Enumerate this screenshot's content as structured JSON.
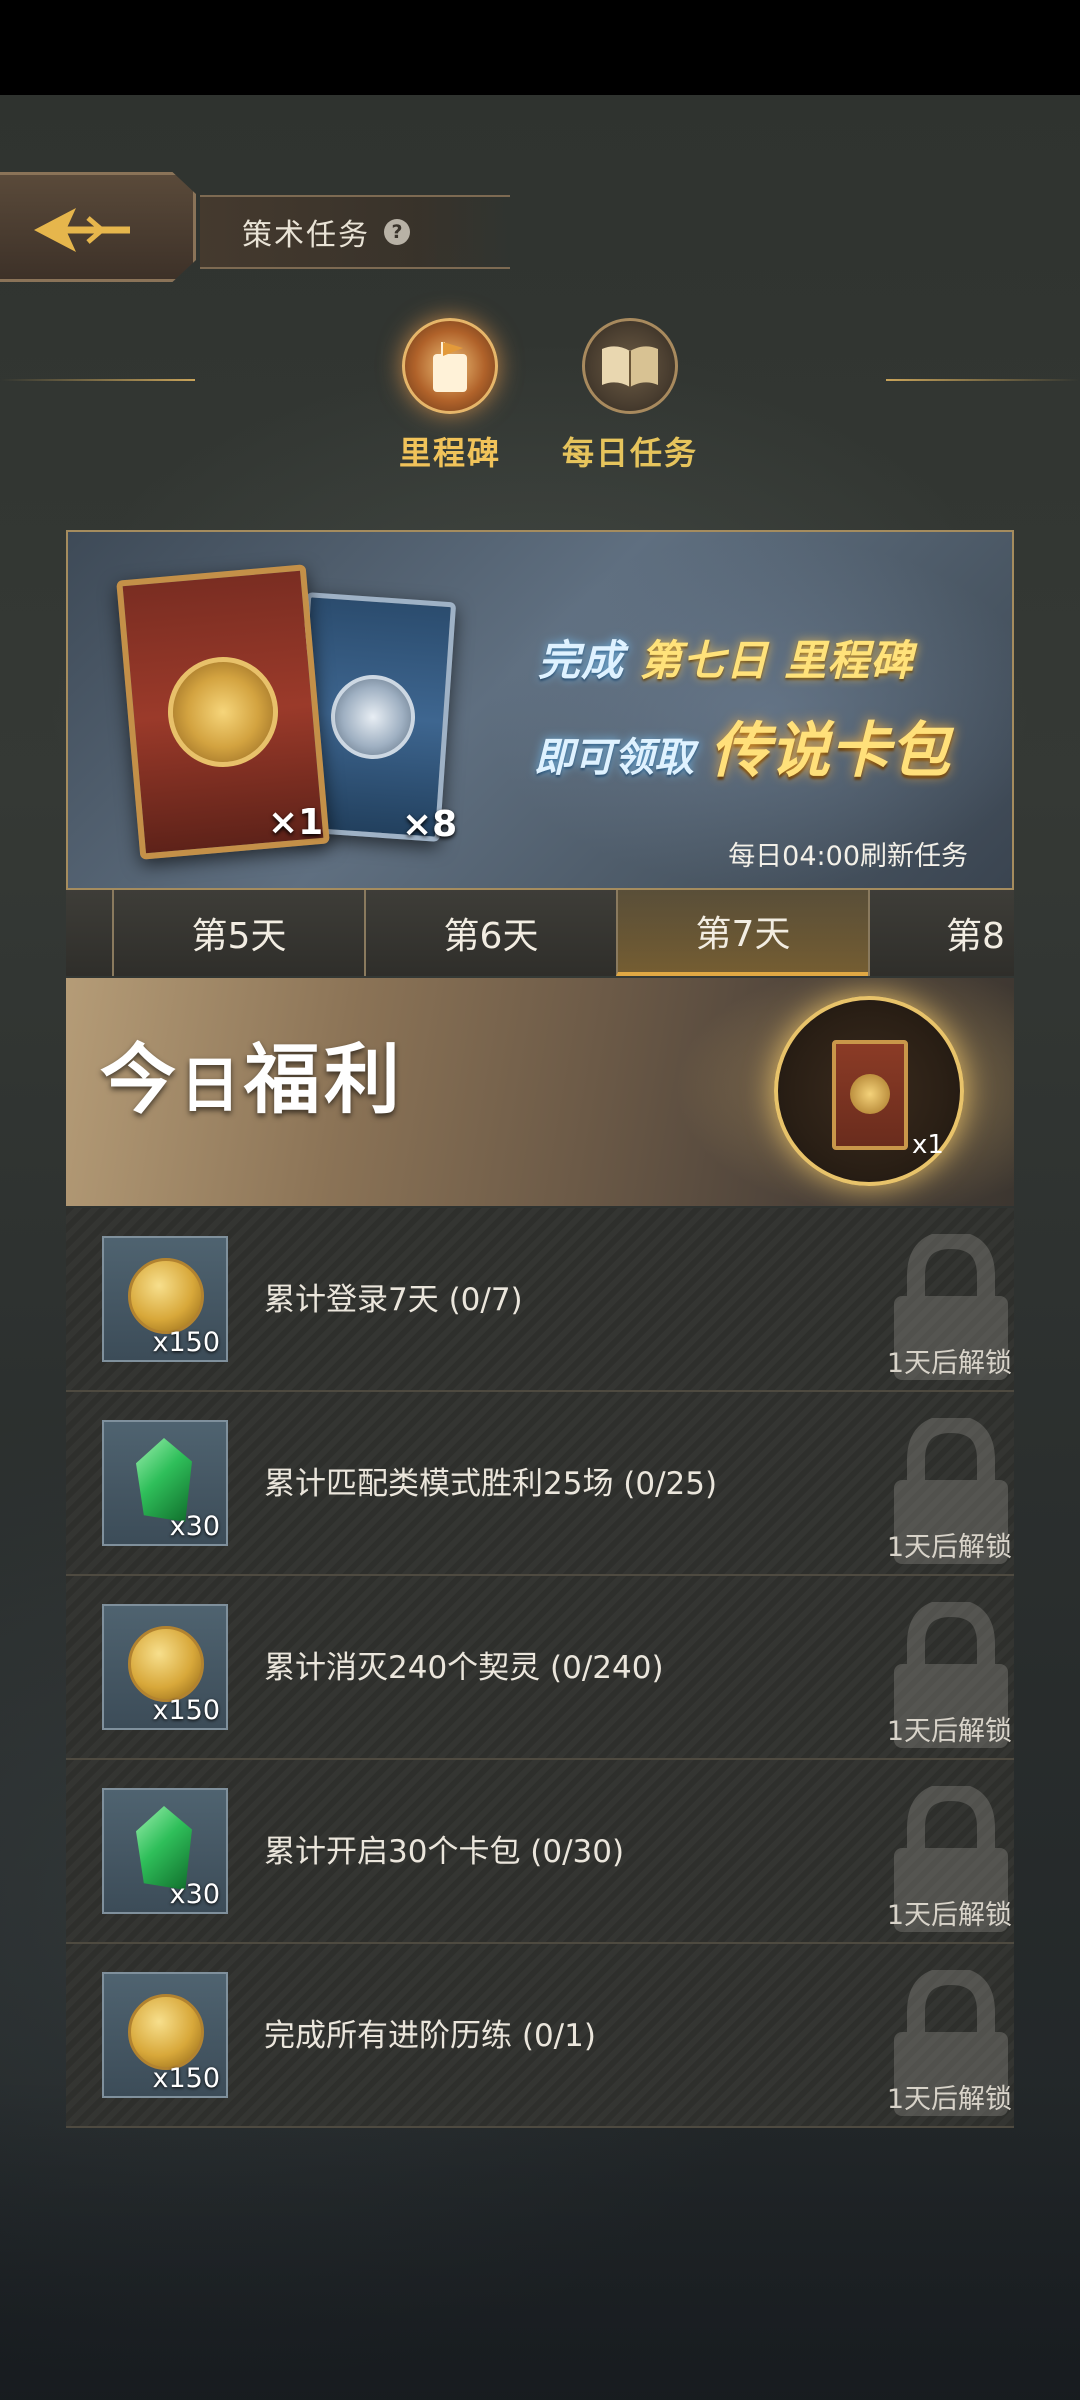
{
  "header": {
    "title": "策术任务",
    "help_icon": "?"
  },
  "top_tabs": [
    {
      "label": "里程碑",
      "icon": "flag-icon",
      "active": true
    },
    {
      "label": "每日任务",
      "icon": "book-icon",
      "active": false
    }
  ],
  "banner": {
    "line1_a": "完成",
    "line1_b": "第七日 里程碑",
    "line2_a": "即可领取",
    "line2_b": "传说卡包",
    "pack1_count": "×1",
    "pack2_count": "×8",
    "refresh_text": "每日04:00刷新任务"
  },
  "day_tabs": [
    {
      "label": "第5天"
    },
    {
      "label": "第6天"
    },
    {
      "label": "第7天",
      "active": true
    },
    {
      "label": "第8"
    }
  ],
  "today": {
    "title_1": "今",
    "title_2": "日",
    "title_3": "福利",
    "reward_count": "x1"
  },
  "tasks": [
    {
      "text": "累计登录7天 (0/7)",
      "reward": "coin",
      "count": "x150",
      "status": "1天后解锁"
    },
    {
      "text": "累计匹配类模式胜利25场 (0/25)",
      "reward": "gem",
      "count": "x30",
      "status": "1天后解锁"
    },
    {
      "text": "累计消灭240个契灵 (0/240)",
      "reward": "coin",
      "count": "x150",
      "status": "1天后解锁"
    },
    {
      "text": "累计开启30个卡包 (0/30)",
      "reward": "gem",
      "count": "x30",
      "status": "1天后解锁"
    },
    {
      "text": "完成所有进阶历练 (0/1)",
      "reward": "coin",
      "count": "x150",
      "status": "1天后解锁"
    }
  ]
}
